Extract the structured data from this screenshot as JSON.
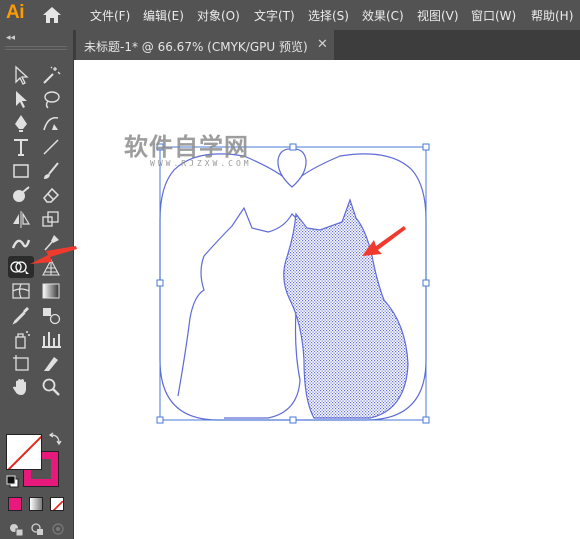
{
  "app": {
    "logo": "Ai",
    "home_icon": "home-icon"
  },
  "menu": {
    "items": [
      "文件(F)",
      "编辑(E)",
      "对象(O)",
      "文字(T)",
      "选择(S)",
      "效果(C)",
      "视图(V)",
      "窗口(W)",
      "帮助(H)"
    ]
  },
  "toolbar": {
    "collapse": "◂◂",
    "tools": [
      "selection-tool",
      "direct-selection-tool",
      "magic-wand-tool",
      "group-selection-tool",
      "pen-tool",
      "curvature-tool",
      "type-tool",
      "line-segment-tool",
      "rectangle-tool",
      "paintbrush-tool",
      "blob-brush-tool",
      "eraser-tool",
      "reflect-tool",
      "scale-tool",
      "width-tool",
      "puppet-warp-tool",
      "shape-builder-tool",
      "perspective-grid-tool",
      "mesh-tool",
      "gradient-tool",
      "eyedropper-tool",
      "blend-tool",
      "symbol-sprayer-tool",
      "column-graph-tool",
      "artboard-tool",
      "slice-tool",
      "hand-tool",
      "zoom-tool"
    ],
    "selected_tool": "shape-builder-tool",
    "fill_color": "#ffffff",
    "stroke_color": "#e8197d",
    "mode_colors": [
      "#e8197d",
      "#bdbdbd",
      "none"
    ]
  },
  "tabs": [
    {
      "title": "未标题-1* @ 66.67% (CMYK/GPU 预览)",
      "close": "✕"
    }
  ],
  "watermark": {
    "main": "软件自学网",
    "sub": "WWW.RJZXW.COM"
  },
  "colors": {
    "path_stroke": "#5f6bd6",
    "selection": "#4a78d9",
    "pointer_arrow": "#f03a2e",
    "chrome": "#535353"
  }
}
